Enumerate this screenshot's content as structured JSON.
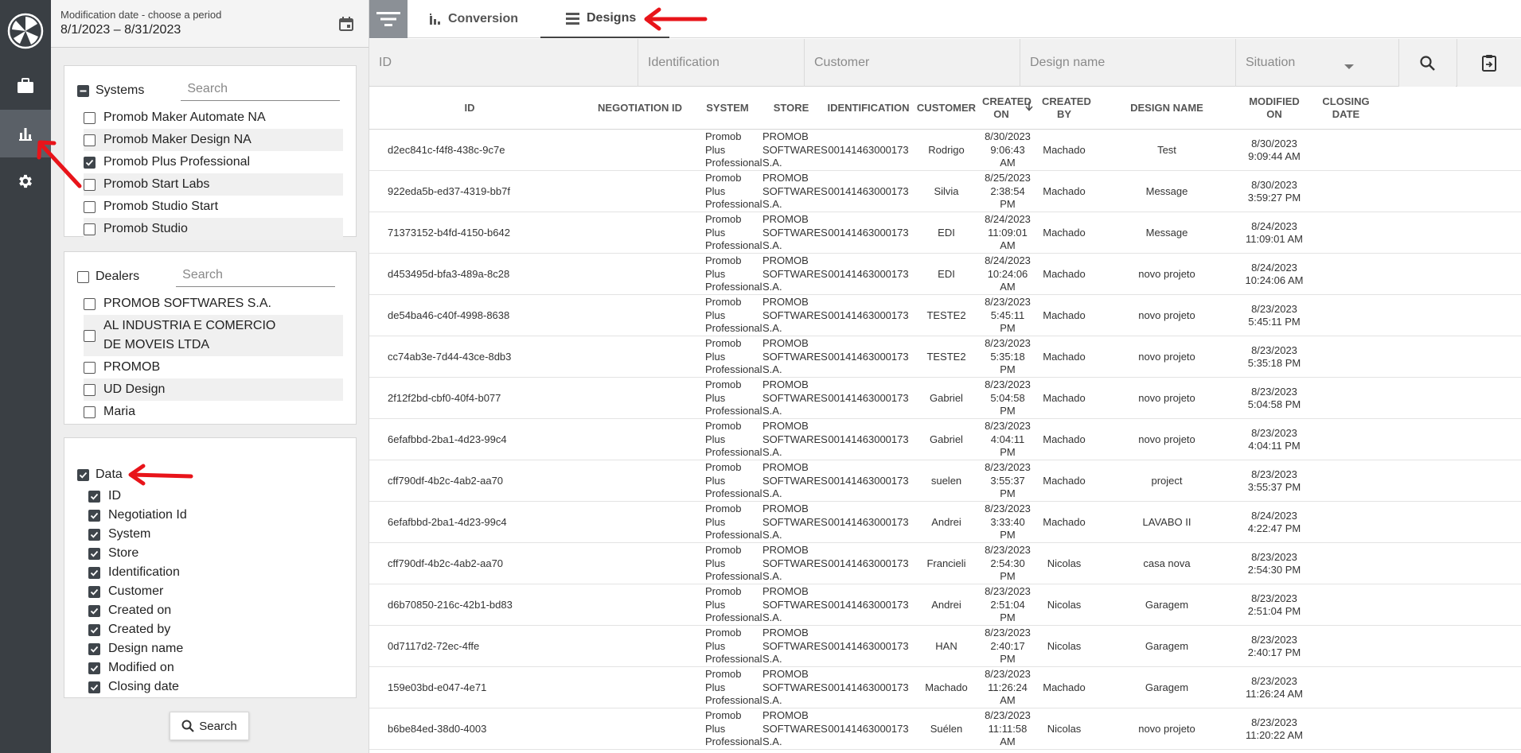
{
  "period": {
    "label": "Modification date - choose a period",
    "value": "8/1/2023 – 8/31/2023"
  },
  "systems": {
    "title": "Systems",
    "search_placeholder": "Search",
    "items": [
      {
        "label": "Promob Maker Automate NA",
        "checked": false
      },
      {
        "label": "Promob Maker Design NA",
        "checked": false
      },
      {
        "label": "Promob Plus Professional",
        "checked": true
      },
      {
        "label": "Promob Start Labs",
        "checked": false
      },
      {
        "label": "Promob Studio Start",
        "checked": false
      },
      {
        "label": "Promob Studio",
        "checked": false
      }
    ]
  },
  "dealers": {
    "title": "Dealers",
    "search_placeholder": "Search",
    "items": [
      {
        "label": "PROMOB SOFTWARES S.A."
      },
      {
        "label": "AL  INDUSTRIA E COMERCIO DE MOVEIS LTDA"
      },
      {
        "label": "PROMOB"
      },
      {
        "label": "UD Design"
      },
      {
        "label": "Maria"
      }
    ]
  },
  "data_section": {
    "title": "Data",
    "items": [
      "ID",
      "Negotiation Id",
      "System",
      "Store",
      "Identification",
      "Customer",
      "Created on",
      "Created by",
      "Design name",
      "Modified on",
      "Closing date"
    ]
  },
  "search_button": "Search",
  "tabs": [
    {
      "label": "Conversion",
      "icon": "bar-chart-icon"
    },
    {
      "label": "Designs",
      "icon": "list-icon",
      "active": true
    }
  ],
  "filters": {
    "id": "ID",
    "identification": "Identification",
    "customer": "Customer",
    "design_name": "Design name",
    "situation": "Situation"
  },
  "columns": [
    "ID",
    "NEGOTIATION ID",
    "SYSTEM",
    "STORE",
    "IDENTIFICATION",
    "CUSTOMER",
    "CREATED ON",
    "CREATED BY",
    "DESIGN NAME",
    "MODIFIED ON",
    "CLOSING DATE"
  ],
  "rows": [
    {
      "id": "d2ec841c-f4f8-438c-9c7e",
      "system": "Promob Plus Professional",
      "store": "PROMOB SOFTWARES S.A.",
      "identification": "00141463000173",
      "customer": "Rodrigo",
      "created_on": "8/30/2023 9:06:43 AM",
      "created_by": "Machado",
      "design_name": "Test",
      "modified_on": "8/30/2023 9:09:44 AM"
    },
    {
      "id": "922eda5b-ed37-4319-bb7f",
      "system": "Promob Plus Professional",
      "store": "PROMOB SOFTWARES S.A.",
      "identification": "00141463000173",
      "customer": "Silvia",
      "created_on": "8/25/2023 2:38:54 PM",
      "created_by": "Machado",
      "design_name": "Message",
      "modified_on": "8/30/2023 3:59:27 PM"
    },
    {
      "id": "71373152-b4fd-4150-b642",
      "system": "Promob Plus Professional",
      "store": "PROMOB SOFTWARES S.A.",
      "identification": "00141463000173",
      "customer": "EDI",
      "created_on": "8/24/2023 11:09:01 AM",
      "created_by": "Machado",
      "design_name": "Message",
      "modified_on": "8/24/2023 11:09:01 AM"
    },
    {
      "id": "d453495d-bfa3-489a-8c28",
      "system": "Promob Plus Professional",
      "store": "PROMOB SOFTWARES S.A.",
      "identification": "00141463000173",
      "customer": "EDI",
      "created_on": "8/24/2023 10:24:06 AM",
      "created_by": "Machado",
      "design_name": "novo projeto",
      "modified_on": "8/24/2023 10:24:06 AM"
    },
    {
      "id": "de54ba46-c40f-4998-8638",
      "system": "Promob Plus Professional",
      "store": "PROMOB SOFTWARES S.A.",
      "identification": "00141463000173",
      "customer": "TESTE2",
      "created_on": "8/23/2023 5:45:11 PM",
      "created_by": "Machado",
      "design_name": "novo projeto",
      "modified_on": "8/23/2023 5:45:11 PM"
    },
    {
      "id": "cc74ab3e-7d44-43ce-8db3",
      "system": "Promob Plus Professional",
      "store": "PROMOB SOFTWARES S.A.",
      "identification": "00141463000173",
      "customer": "TESTE2",
      "created_on": "8/23/2023 5:35:18 PM",
      "created_by": "Machado",
      "design_name": "novo projeto",
      "modified_on": "8/23/2023 5:35:18 PM"
    },
    {
      "id": "2f12f2bd-cbf0-40f4-b077",
      "system": "Promob Plus Professional",
      "store": "PROMOB SOFTWARES S.A.",
      "identification": "00141463000173",
      "customer": "Gabriel",
      "created_on": "8/23/2023 5:04:58 PM",
      "created_by": "Machado",
      "design_name": "novo projeto",
      "modified_on": "8/23/2023 5:04:58 PM"
    },
    {
      "id": "6efafbbd-2ba1-4d23-99c4",
      "system": "Promob Plus Professional",
      "store": "PROMOB SOFTWARES S.A.",
      "identification": "00141463000173",
      "customer": "Gabriel",
      "created_on": "8/23/2023 4:04:11 PM",
      "created_by": "Machado",
      "design_name": "novo projeto",
      "modified_on": "8/23/2023 4:04:11 PM"
    },
    {
      "id": "cff790df-4b2c-4ab2-aa70",
      "system": "Promob Plus Professional",
      "store": "PROMOB SOFTWARES S.A.",
      "identification": "00141463000173",
      "customer": "suelen",
      "created_on": "8/23/2023 3:55:37 PM",
      "created_by": "Machado",
      "design_name": "project",
      "modified_on": "8/23/2023 3:55:37 PM"
    },
    {
      "id": "6efafbbd-2ba1-4d23-99c4",
      "system": "Promob Plus Professional",
      "store": "PROMOB SOFTWARES S.A.",
      "identification": "00141463000173",
      "customer": "Andrei",
      "created_on": "8/23/2023 3:33:40 PM",
      "created_by": "Machado",
      "design_name": "LAVABO II",
      "modified_on": "8/24/2023 4:22:47 PM"
    },
    {
      "id": "cff790df-4b2c-4ab2-aa70",
      "system": "Promob Plus Professional",
      "store": "PROMOB SOFTWARES S.A.",
      "identification": "00141463000173",
      "customer": "Francieli",
      "created_on": "8/23/2023 2:54:30 PM",
      "created_by": "Nicolas",
      "design_name": "casa nova",
      "modified_on": "8/23/2023 2:54:30 PM"
    },
    {
      "id": "d6b70850-216c-42b1-bd83",
      "system": "Promob Plus Professional",
      "store": "PROMOB SOFTWARES S.A.",
      "identification": "00141463000173",
      "customer": "Andrei",
      "created_on": "8/23/2023 2:51:04 PM",
      "created_by": "Nicolas",
      "design_name": "Garagem",
      "modified_on": "8/23/2023 2:51:04 PM"
    },
    {
      "id": "0d7117d2-72ec-4ffe",
      "system": "Promob Plus Professional",
      "store": "PROMOB SOFTWARES S.A.",
      "identification": "00141463000173",
      "customer": "HAN",
      "created_on": "8/23/2023 2:40:17 PM",
      "created_by": "Nicolas",
      "design_name": "Garagem",
      "modified_on": "8/23/2023 2:40:17 PM"
    },
    {
      "id": "159e03bd-e047-4e71",
      "system": "Promob Plus Professional",
      "store": "PROMOB SOFTWARES S.A.",
      "identification": "00141463000173",
      "customer": "Machado",
      "created_on": "8/23/2023 11:26:24 AM",
      "created_by": "Machado",
      "design_name": "Garagem",
      "modified_on": "8/23/2023 11:26:24 AM"
    },
    {
      "id": "b6be84ed-38d0-4003",
      "system": "Promob Plus Professional",
      "store": "PROMOB SOFTWARES S.A.",
      "identification": "00141463000173",
      "customer": "Suélen",
      "created_on": "8/23/2023 11:11:58 AM",
      "created_by": "Nicolas",
      "design_name": "novo projeto",
      "modified_on": "8/23/2023 11:20:22 AM"
    }
  ],
  "colors": {
    "rail": "#3a3f44",
    "rail_active": "#5a6067",
    "annotation": "#e8141a"
  }
}
